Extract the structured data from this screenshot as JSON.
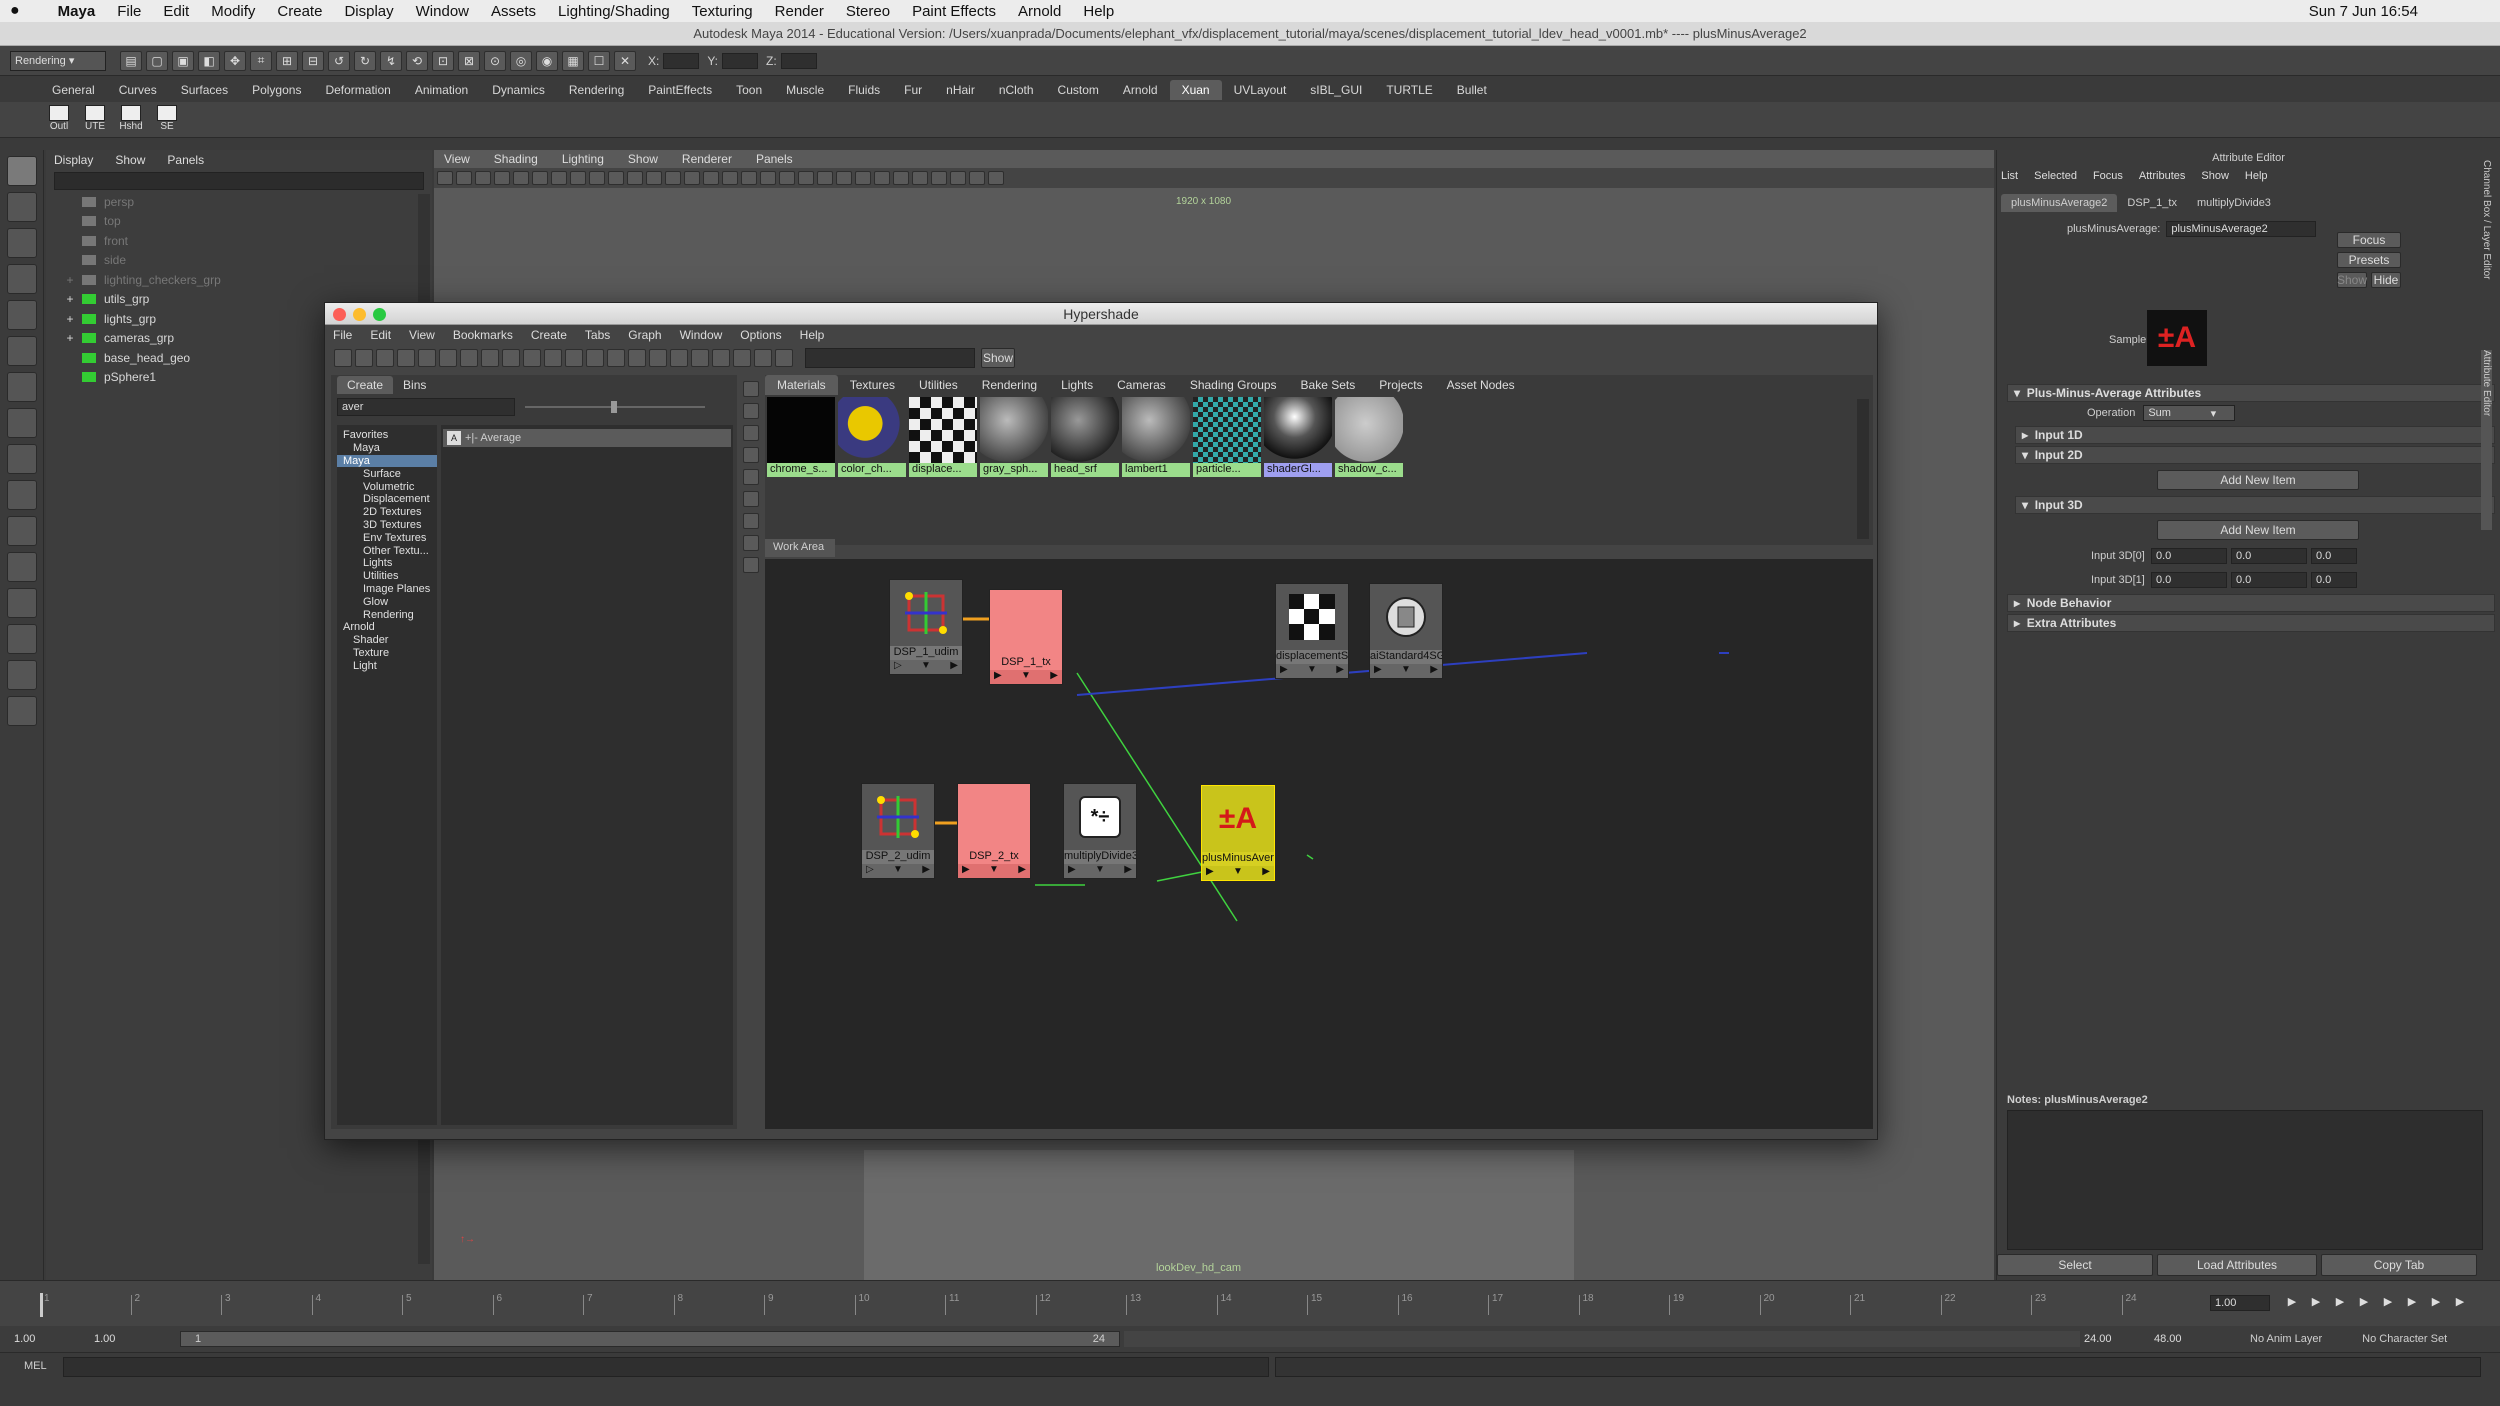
{
  "mac_menu": {
    "items": [
      "Maya",
      "File",
      "Edit",
      "Modify",
      "Create",
      "Display",
      "Window",
      "Assets",
      "Lighting/Shading",
      "Texturing",
      "Render",
      "Stereo",
      "Paint Effects",
      "Arnold",
      "Help"
    ],
    "clock": "Sun 7 Jun  16:54"
  },
  "window_title": "Autodesk Maya 2014 - Educational Version: /Users/xuanprada/Documents/elephant_vfx/displacement_tutorial/maya/scenes/displacement_tutorial_ldev_head_v0001.mb*  ----  plusMinusAverage2",
  "toolbar": {
    "mode": "Rendering",
    "x_label": "X:",
    "y_label": "Y:",
    "z_label": "Z:"
  },
  "shelf_tabs": [
    "General",
    "Curves",
    "Surfaces",
    "Polygons",
    "Deformation",
    "Animation",
    "Dynamics",
    "Rendering",
    "PaintEffects",
    "Toon",
    "Muscle",
    "Fluids",
    "Fur",
    "nHair",
    "nCloth",
    "Custom",
    "Arnold",
    "Xuan",
    "UVLayout",
    "sIBL_GUI",
    "TURTLE",
    "Bullet"
  ],
  "shelf_active": "Xuan",
  "shelf_buttons": [
    "Outl",
    "UTE",
    "Hshd",
    "SE"
  ],
  "outliner": {
    "menu": [
      "Display",
      "Show",
      "Panels"
    ],
    "items": [
      {
        "name": "persp",
        "dim": true,
        "expand": ""
      },
      {
        "name": "top",
        "dim": true,
        "expand": ""
      },
      {
        "name": "front",
        "dim": true,
        "expand": ""
      },
      {
        "name": "side",
        "dim": true,
        "expand": ""
      },
      {
        "name": "lighting_checkers_grp",
        "dim": true,
        "expand": "+"
      },
      {
        "name": "utils_grp",
        "dim": false,
        "expand": "+"
      },
      {
        "name": "lights_grp",
        "dim": false,
        "expand": "+"
      },
      {
        "name": "cameras_grp",
        "dim": false,
        "expand": "+"
      },
      {
        "name": "base_head_geo",
        "dim": false,
        "expand": ""
      },
      {
        "name": "pSphere1",
        "dim": false,
        "expand": ""
      }
    ]
  },
  "viewport": {
    "menu": [
      "View",
      "Shading",
      "Lighting",
      "Show",
      "Renderer",
      "Panels"
    ],
    "resolution": "1920 x 1080",
    "camera": "lookDev_hd_cam"
  },
  "hypershade": {
    "title": "Hypershade",
    "menu": [
      "File",
      "Edit",
      "View",
      "Bookmarks",
      "Create",
      "Tabs",
      "Graph",
      "Window",
      "Options",
      "Help"
    ],
    "show_label": "Show",
    "left_tabs": [
      "Create",
      "Bins"
    ],
    "search_value": "aver",
    "result": "+|- Average",
    "tree": [
      {
        "label": "Favorites",
        "level": 0,
        "sel": false
      },
      {
        "label": "Maya",
        "level": 1,
        "sel": false
      },
      {
        "label": "Maya",
        "level": 0,
        "sel": true
      },
      {
        "label": "Surface",
        "level": 2,
        "sel": false
      },
      {
        "label": "Volumetric",
        "level": 2,
        "sel": false
      },
      {
        "label": "Displacement",
        "level": 2,
        "sel": false
      },
      {
        "label": "2D Textures",
        "level": 2,
        "sel": false
      },
      {
        "label": "3D Textures",
        "level": 2,
        "sel": false
      },
      {
        "label": "Env Textures",
        "level": 2,
        "sel": false
      },
      {
        "label": "Other Textu...",
        "level": 2,
        "sel": false
      },
      {
        "label": "Lights",
        "level": 2,
        "sel": false
      },
      {
        "label": "Utilities",
        "level": 2,
        "sel": false
      },
      {
        "label": "Image Planes",
        "level": 2,
        "sel": false
      },
      {
        "label": "Glow",
        "level": 2,
        "sel": false
      },
      {
        "label": "Rendering",
        "level": 2,
        "sel": false
      },
      {
        "label": "Arnold",
        "level": 0,
        "sel": false
      },
      {
        "label": "Shader",
        "level": 1,
        "sel": false
      },
      {
        "label": "Texture",
        "level": 1,
        "sel": false
      },
      {
        "label": "Light",
        "level": 1,
        "sel": false
      }
    ],
    "material_tabs": [
      "Materials",
      "Textures",
      "Utilities",
      "Rendering",
      "Lights",
      "Cameras",
      "Shading Groups",
      "Bake Sets",
      "Projects",
      "Asset Nodes"
    ],
    "swatches": [
      {
        "label": "chrome_s...",
        "kind": "black"
      },
      {
        "label": "color_ch...",
        "kind": "colorball"
      },
      {
        "label": "displace...",
        "kind": "checker"
      },
      {
        "label": "gray_sph...",
        "kind": "gray"
      },
      {
        "label": "head_srf",
        "kind": "dark"
      },
      {
        "label": "lambert1",
        "kind": "gray"
      },
      {
        "label": "particle...",
        "kind": "particle"
      },
      {
        "label": "shaderGl...",
        "kind": "chrome"
      },
      {
        "label": "shadow_c...",
        "kind": "light"
      }
    ],
    "work_area_label": "Work Area",
    "nodes": {
      "dsp1_udim": "DSP_1_udim",
      "dsp1_tx": "DSP_1_tx",
      "disp_shader": "displacementSha...",
      "ai_standard": "aiStandard4SG",
      "dsp2_udim": "DSP_2_udim",
      "dsp2_tx": "DSP_2_tx",
      "multiply": "multiplyDivide3",
      "plus_minus": "plusMinusAverag..."
    },
    "multiply_symbol": "*÷",
    "plus_symbol": "±A"
  },
  "attribute_editor": {
    "title": "Attribute Editor",
    "menu": [
      "List",
      "Selected",
      "Focus",
      "Attributes",
      "Show",
      "Help"
    ],
    "tabs": [
      "plusMinusAverage2",
      "DSP_1_tx",
      "multiplyDivide3"
    ],
    "node_type_label": "plusMinusAverage:",
    "node_name": "plusMinusAverage2",
    "focus_button": "Focus",
    "presets_button": "Presets",
    "show_button": "Show",
    "hide_button": "Hide",
    "sample_label": "Sample",
    "section_main": "Plus-Minus-Average Attributes",
    "operation_label": "Operation",
    "operation_value": "Sum",
    "input1d": "Input 1D",
    "input2d": "Input 2D",
    "input3d": "Input 3D",
    "add_item": "Add New Item",
    "in3d0_label": "Input 3D[0]",
    "in3d1_label": "Input 3D[1]",
    "val": "0.0",
    "node_behavior": "Node Behavior",
    "extra": "Extra Attributes",
    "notes": "Notes:  plusMinusAverage2",
    "select_button": "Select",
    "load_button": "Load Attributes",
    "copy_button": "Copy Tab",
    "side_tabs": [
      "Channel Box / Layer Editor",
      "Attribute Editor"
    ]
  },
  "timeline": {
    "ticks": [
      "1",
      "2",
      "3",
      "4",
      "5",
      "6",
      "7",
      "8",
      "9",
      "10",
      "11",
      "12",
      "13",
      "14",
      "15",
      "16",
      "17",
      "18",
      "19",
      "20",
      "21",
      "22",
      "23",
      "24"
    ],
    "current_frame": "1.00",
    "range_start": "1.00",
    "range_start2": "1.00",
    "range_slider_start": "1",
    "range_slider_end": "24",
    "range_end": "24.00",
    "range_end2": "48.00",
    "anim_layer": "No Anim Layer",
    "char_set": "No Character Set"
  },
  "mel_label": "MEL"
}
